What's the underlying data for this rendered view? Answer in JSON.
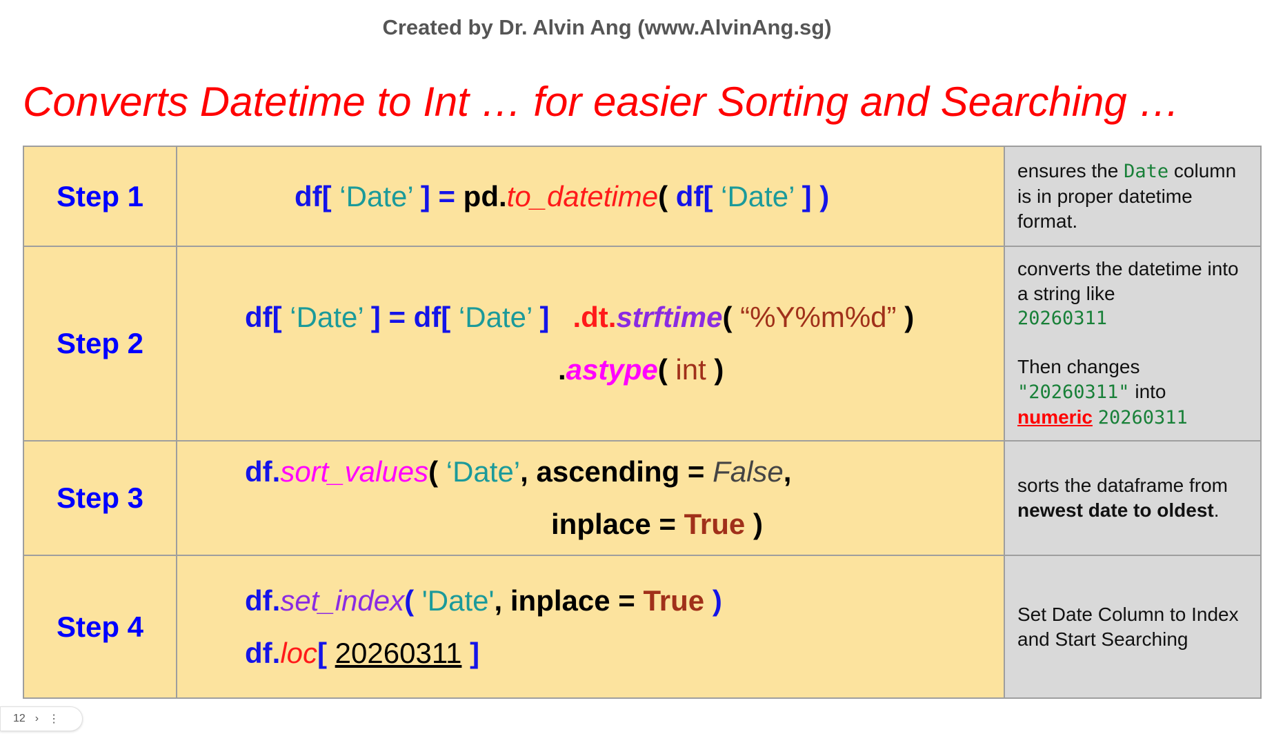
{
  "header": {
    "credit": "Created by Dr. Alvin Ang (www.AlvinAng.sg)",
    "title": "Converts Datetime to Int … for easier Sorting and Searching …"
  },
  "steps": [
    {
      "label": "Step 1",
      "code": {
        "df_open": "df[",
        "date_a": " ‘Date’ ",
        "close_eq": "] = ",
        "pd": "pd.",
        "fn": "to_datetime",
        "paren_open": "( ",
        "df_open2": "df[",
        "date_b": " ‘Date’ ",
        "close_end": "] )"
      },
      "description": {
        "pre": "ensures the ",
        "code": "Date",
        "post": " column is in proper datetime format."
      }
    },
    {
      "label": "Step 2",
      "code": {
        "df_open": "df[",
        "date_a": " ‘Date’ ",
        "close_eq": "] = df[",
        "date_b": " ‘Date’ ",
        "close": "]",
        "dt": ".dt.",
        "fn": "strftime",
        "paren_open": "( ",
        "fmt": "“%Y%m%d”",
        "paren_close": " )",
        "dot": ".",
        "fn2": "astype",
        "paren_open2": "( ",
        "arg": "int",
        "paren_close2": " )"
      },
      "description": {
        "line1": "converts the datetime into a string like",
        "code1": "20260311",
        "line2": "Then changes",
        "code2": "\"20260311\"",
        "into": " into",
        "link": "numeric",
        "code3": "20260311"
      }
    },
    {
      "label": "Step 3",
      "code": {
        "df": "df.",
        "fn": "sort_values",
        "paren_open": "( ",
        "date": "‘Date’",
        "comma": ", ascending = ",
        "false": "False",
        "comma2": ",",
        "inplace": "inplace = ",
        "true": "True",
        "paren_close": " )"
      },
      "description": {
        "line1": "sorts the dataframe from",
        "bold": "newest date to oldest",
        "end": "."
      }
    },
    {
      "label": "Step 4",
      "code": {
        "df": "df.",
        "fn": "set_index",
        "paren_open": "( ",
        "date": "'Date'",
        "comma": ", inplace = ",
        "true": "True",
        "paren_close": " )",
        "df2": "df.",
        "fn2": "loc",
        "bracket_open": "[ ",
        "value": "20260311",
        "bracket_close": " ]"
      },
      "description": {
        "text": "Set Date Column to Index and Start Searching"
      }
    }
  ],
  "slide_badge": {
    "number": "12",
    "next_icon": "chevron-right-icon",
    "menu_icon": "more-vert-icon"
  }
}
